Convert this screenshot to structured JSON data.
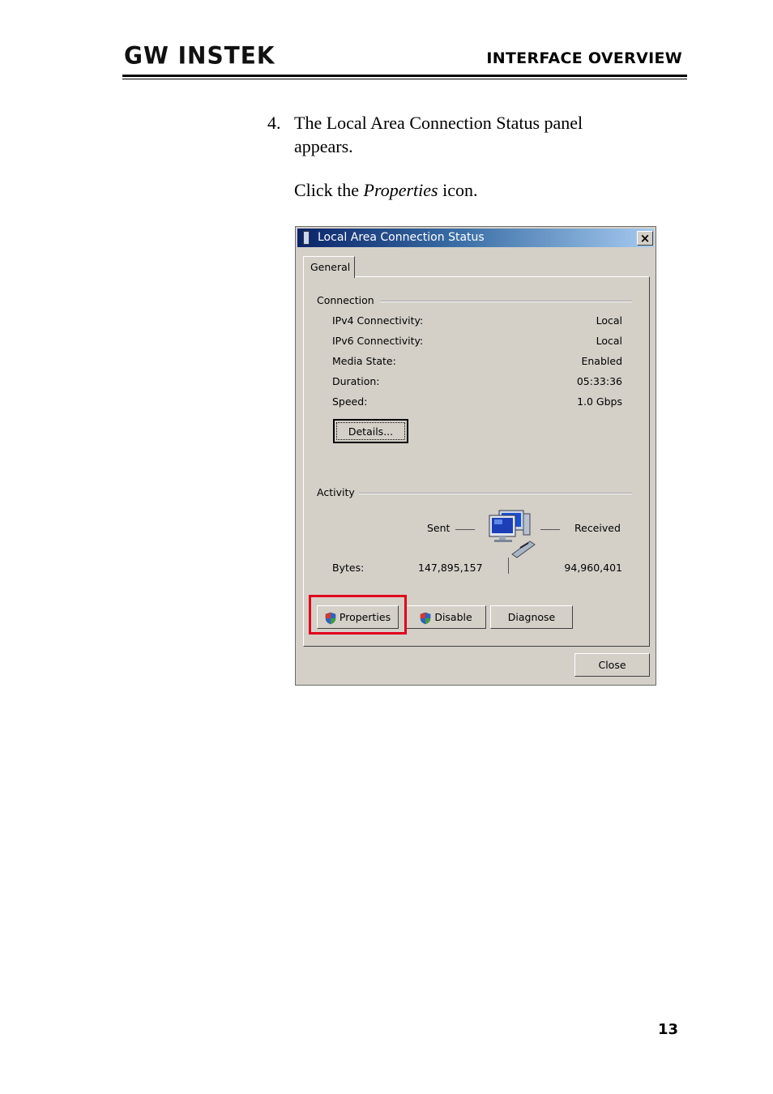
{
  "header": {
    "logo": "GW INSTEK",
    "section": "INTERFACE OVERVIEW"
  },
  "step": {
    "number": "4.",
    "text": "The Local Area Connection Status panel appears.",
    "instruction_prefix": "Click the ",
    "instruction_emphasis": "Properties",
    "instruction_suffix": " icon."
  },
  "dialog": {
    "title": "Local Area Connection Status",
    "close_glyph": "×",
    "tab": "General",
    "connection_group": "Connection",
    "connection_rows": [
      {
        "label": "IPv4 Connectivity:",
        "value": "Local"
      },
      {
        "label": "IPv6 Connectivity:",
        "value": "Local"
      },
      {
        "label": "Media State:",
        "value": "Enabled"
      },
      {
        "label": "Duration:",
        "value": "05:33:36"
      },
      {
        "label": "Speed:",
        "value": "1.0 Gbps"
      }
    ],
    "details_button": "Details...",
    "activity_group": "Activity",
    "sent_label": "Sent",
    "received_label": "Received",
    "bytes_label": "Bytes:",
    "bytes_sent": "147,895,157",
    "bytes_received": "94,960,401",
    "buttons": {
      "properties": "Properties",
      "disable": "Disable",
      "diagnose": "Diagnose",
      "close": "Close"
    },
    "icons": {
      "title": "network-adapter-icon",
      "activity": "network-computers-icon",
      "shield": "uac-shield-icon"
    },
    "highlight_color": "#e0001b"
  },
  "page_number": "13"
}
